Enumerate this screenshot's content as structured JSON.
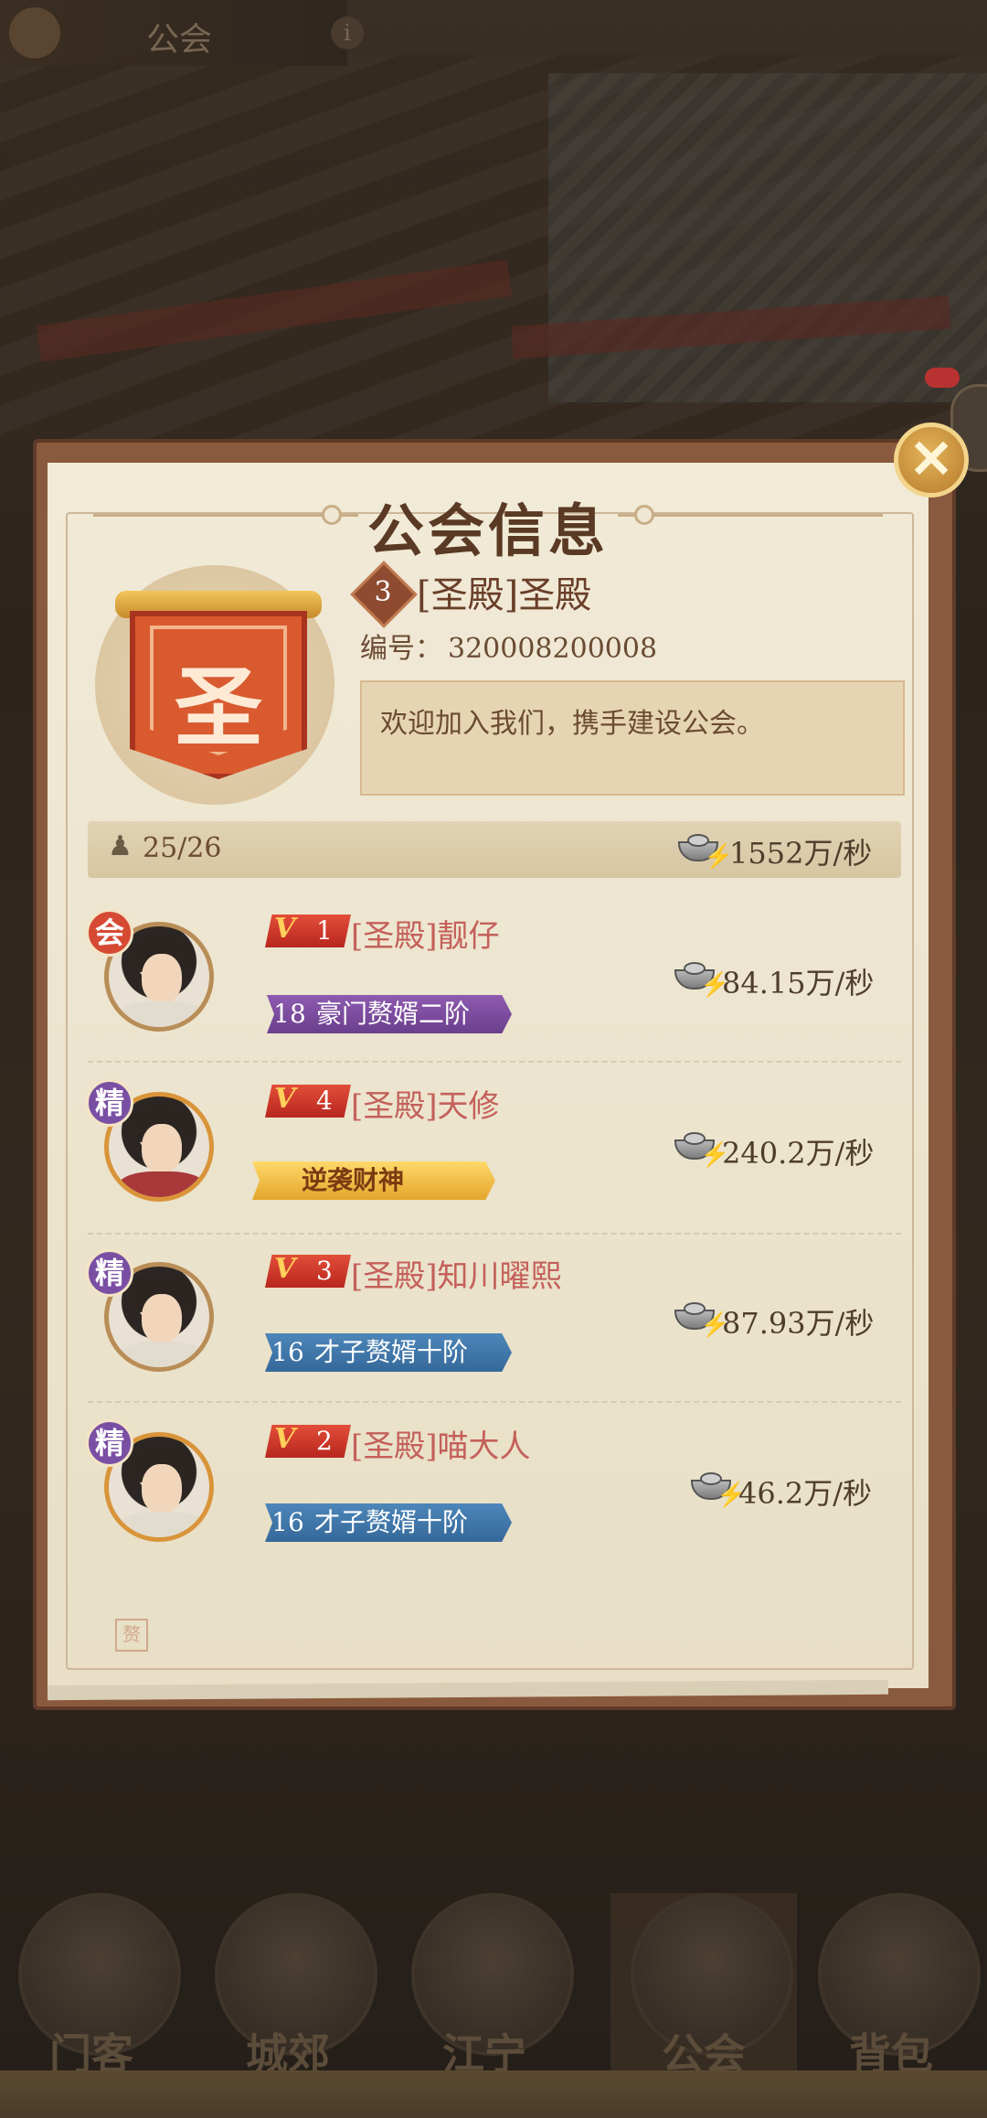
{
  "top_bar": {
    "title": "公会",
    "info": "i"
  },
  "dialog": {
    "title": "公会信息",
    "close": "✕",
    "guild": {
      "emblem_char": "圣",
      "level": "3",
      "name": "[圣殿]圣殿",
      "id_label": "编号：",
      "id_value": "320008200008",
      "notice": "欢迎加入我们，携手建设公会。"
    },
    "stats": {
      "members": "25/26",
      "income": "1552万/秒"
    },
    "members": [
      {
        "role": "会",
        "role_color": "#d64a34",
        "vip": "1",
        "name": "[圣殿]靓仔",
        "title_level": "18",
        "title": "豪门赘婿二阶",
        "title_style": "purple",
        "income": "84.15万/秒"
      },
      {
        "role": "精",
        "role_color": "#7a4fa3",
        "vip": "4",
        "name": "[圣殿]天修",
        "title_level": "",
        "title": "逆袭财神",
        "title_style": "gold",
        "income": "240.2万/秒"
      },
      {
        "role": "精",
        "role_color": "#7a4fa3",
        "vip": "3",
        "name": "[圣殿]知川曜熙",
        "title_level": "16",
        "title": "才子赘婿十阶",
        "title_style": "blue",
        "income": "87.93万/秒"
      },
      {
        "role": "精",
        "role_color": "#7a4fa3",
        "vip": "2",
        "name": "[圣殿]喵大人",
        "title_level": "16",
        "title": "才子赘婿十阶",
        "title_style": "blue",
        "income": "46.2万/秒"
      }
    ],
    "seal": "赘"
  },
  "bottom_nav": [
    {
      "label": "门客"
    },
    {
      "label": "城郊"
    },
    {
      "label": "江宁"
    },
    {
      "label": "公会"
    },
    {
      "label": "背包"
    }
  ],
  "icons": [
    "guild-emblem-icon",
    "info-icon",
    "close-icon",
    "member-icon",
    "silver-ingot-icon",
    "vip-icon"
  ]
}
